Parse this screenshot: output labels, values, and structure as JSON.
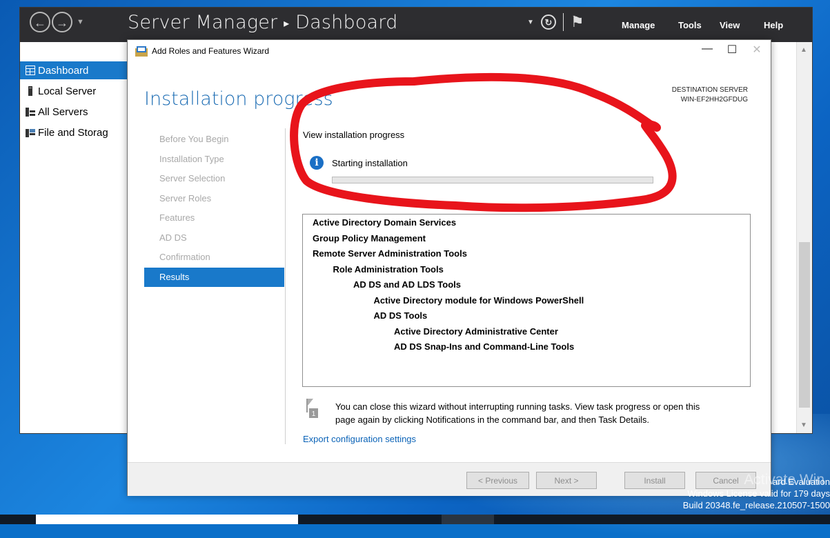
{
  "server_manager": {
    "title": "Server Manager",
    "breadcrumb_sep": "▸",
    "page": "Dashboard",
    "menu": [
      "Manage",
      "Tools",
      "View",
      "Help"
    ],
    "sidebar": [
      {
        "label": "Dashboard",
        "icon": "dashboard-icon",
        "active": true
      },
      {
        "label": "Local Server",
        "icon": "server-icon"
      },
      {
        "label": "All Servers",
        "icon": "servers-icon"
      },
      {
        "label": "File and Storag",
        "icon": "storage-icon"
      }
    ]
  },
  "wizard": {
    "title": "Add Roles and Features Wizard",
    "heading": "Installation progress",
    "destination_label": "DESTINATION SERVER",
    "destination_server": "WIN-EF2HH2GFDUG",
    "steps": [
      "Before You Begin",
      "Installation Type",
      "Server Selection",
      "Server Roles",
      "Features",
      "AD DS",
      "Confirmation",
      "Results"
    ],
    "current_step": "Results",
    "view_progress_label": "View installation progress",
    "status_text": "Starting installation",
    "progress_fraction": 0,
    "features": [
      {
        "text": "Active Directory Domain Services",
        "level": 0
      },
      {
        "text": "Group Policy Management",
        "level": 0
      },
      {
        "text": "Remote Server Administration Tools",
        "level": 0
      },
      {
        "text": "Role Administration Tools",
        "level": 1
      },
      {
        "text": "AD DS and AD LDS Tools",
        "level": 2
      },
      {
        "text": "Active Directory module for Windows PowerShell",
        "level": 3
      },
      {
        "text": "AD DS Tools",
        "level": 3
      },
      {
        "text": "Active Directory Administrative Center",
        "level": 4
      },
      {
        "text": "AD DS Snap-Ins and Command-Line Tools",
        "level": 4
      }
    ],
    "notice_line1": "You can close this wizard without interrupting running tasks. View task progress or open this",
    "notice_line2": "page again by clicking Notifications in the command bar, and then Task Details.",
    "export_link": "Export configuration settings",
    "buttons": {
      "previous": "< Previous",
      "next": "Next >",
      "install": "Install",
      "cancel": "Cancel"
    }
  },
  "watermark": {
    "line1": "ard Evaluation",
    "line2": "Windows License valid for 179 days",
    "line3": "Build 20348.fe_release.210507-1500",
    "overlay": "Activate Win"
  },
  "colors": {
    "accent": "#1979ca",
    "heading": "#1d6db4",
    "annotation": "#e8141b",
    "titlebar": "#2d2d30"
  }
}
